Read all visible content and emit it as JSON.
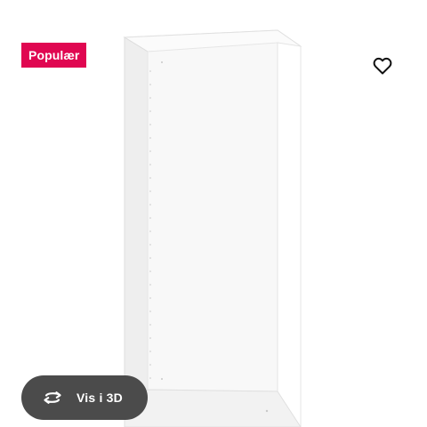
{
  "product_card": {
    "badge": "Populær",
    "view_3d_label": "Vis i 3D",
    "icons": {
      "favourite": "heart-outline-icon",
      "view_3d": "rotate-arrows-icon"
    },
    "image": "white-wardrobe-frame",
    "colors": {
      "badge_bg": "#e00751",
      "badge_text": "#ffffff",
      "view_3d_bg": "#4b4b4b",
      "icon": "#111111"
    }
  }
}
